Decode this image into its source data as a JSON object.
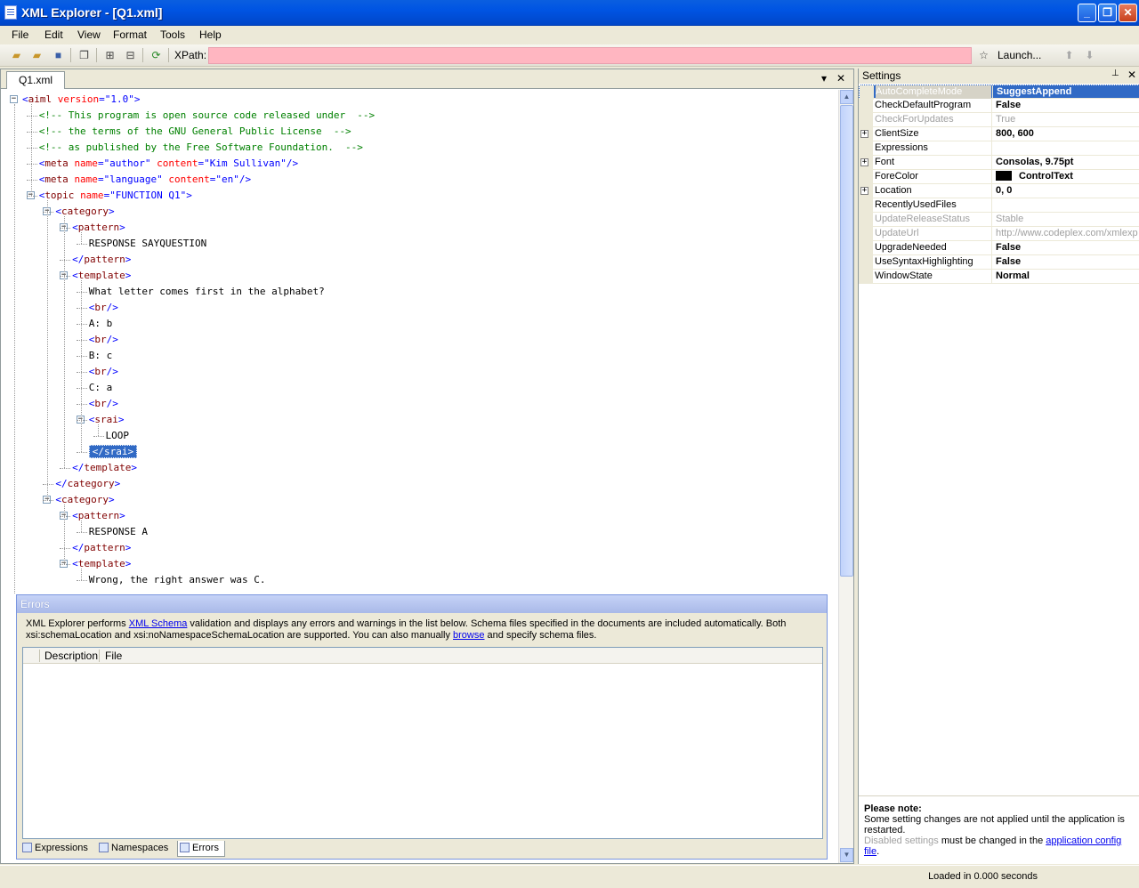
{
  "window": {
    "title": "XML Explorer - [Q1.xml]",
    "minimize": "_",
    "maximize": "❐",
    "close": "✕"
  },
  "menu": [
    "File",
    "Edit",
    "View",
    "Format",
    "Tools",
    "Help"
  ],
  "toolbar": {
    "xpath_label": "XPath:",
    "xpath_value": "",
    "launch_label": "Launch...",
    "icons": [
      "open-icon",
      "open-folder-icon",
      "save-icon",
      "copy-icon",
      "expand-all-icon",
      "collapse-all-icon",
      "refresh-icon",
      "star-icon",
      "launch-icon",
      "up-arrow-icon",
      "down-arrow-icon"
    ]
  },
  "editor": {
    "tab": "Q1.xml",
    "lines": [
      {
        "kind": "element",
        "text": "<aiml",
        "attrs": [
          {
            "n": "version",
            "v": "\"1.0\""
          }
        ],
        "close": ">"
      },
      {
        "kind": "comment",
        "text": "<!-- This program is open source code released under  -->"
      },
      {
        "kind": "comment",
        "text": "<!-- the terms of the GNU General Public License  -->"
      },
      {
        "kind": "comment",
        "text": "<!-- as published by the Free Software Foundation.  -->"
      },
      {
        "kind": "element",
        "text": "<meta",
        "attrs": [
          {
            "n": "name",
            "v": "\"author\""
          },
          {
            "n": "content",
            "v": "\"Kim Sullivan\""
          }
        ],
        "close": "/>"
      },
      {
        "kind": "element",
        "text": "<meta",
        "attrs": [
          {
            "n": "name",
            "v": "\"language\""
          },
          {
            "n": "content",
            "v": "\"en\""
          }
        ],
        "close": "/>"
      },
      {
        "kind": "element",
        "text": "<topic",
        "attrs": [
          {
            "n": "name",
            "v": "\"FUNCTION Q1\""
          }
        ],
        "close": ">"
      },
      {
        "kind": "element",
        "text": "<category",
        "attrs": [],
        "close": ">"
      },
      {
        "kind": "element",
        "text": "<pattern",
        "attrs": [],
        "close": ">"
      },
      {
        "kind": "text",
        "text": "RESPONSE SAYQUESTION"
      },
      {
        "kind": "endtag",
        "text": "</pattern>"
      },
      {
        "kind": "element",
        "text": "<template",
        "attrs": [],
        "close": ">"
      },
      {
        "kind": "text",
        "text": "What letter comes first in the alphabet?"
      },
      {
        "kind": "endtag",
        "text": "<br/>"
      },
      {
        "kind": "text",
        "text": "A: b"
      },
      {
        "kind": "endtag",
        "text": "<br/>"
      },
      {
        "kind": "text",
        "text": "B: c"
      },
      {
        "kind": "endtag",
        "text": "<br/>"
      },
      {
        "kind": "text",
        "text": "C: a"
      },
      {
        "kind": "endtag",
        "text": "<br/>"
      },
      {
        "kind": "element",
        "text": "<srai",
        "attrs": [],
        "close": ">"
      },
      {
        "kind": "text",
        "text": "LOOP"
      },
      {
        "kind": "endtag",
        "text": "</srai>",
        "selected": true
      },
      {
        "kind": "endtag",
        "text": "</template>"
      },
      {
        "kind": "endtag",
        "text": "</category>"
      },
      {
        "kind": "element",
        "text": "<category",
        "attrs": [],
        "close": ">"
      },
      {
        "kind": "element",
        "text": "<pattern",
        "attrs": [],
        "close": ">"
      },
      {
        "kind": "text",
        "text": "RESPONSE A"
      },
      {
        "kind": "endtag",
        "text": "</pattern>"
      },
      {
        "kind": "element",
        "text": "<template",
        "attrs": [],
        "close": ">"
      },
      {
        "kind": "text",
        "text": "Wrong, the right answer was C."
      }
    ]
  },
  "errors": {
    "title": "Errors",
    "message_1": "XML Explorer performs ",
    "link_schema": "XML Schema",
    "message_2": " validation and displays any errors and warnings in the list below. Schema files specified in the documents are included automatically. Both xsi:schemaLocation and xsi:noNamespaceSchemaLocation are supported. You can also manually ",
    "link_browse": "browse",
    "message_3": " and specify schema files.",
    "columns": [
      "Description",
      "File"
    ],
    "tabs": [
      "Expressions",
      "Namespaces",
      "Errors"
    ]
  },
  "settings": {
    "title": "Settings",
    "pin": "📌",
    "close": "✕",
    "rows": [
      {
        "name": "AutoCompleteMode",
        "value": "SuggestAppend",
        "selected": true
      },
      {
        "name": "CheckDefaultProgram",
        "value": "False"
      },
      {
        "name": "CheckForUpdates",
        "value": "True",
        "disabled": true
      },
      {
        "name": "ClientSize",
        "value": "800, 600",
        "expandable": true
      },
      {
        "name": "Expressions",
        "value": ""
      },
      {
        "name": "Font",
        "value": "Consolas, 9.75pt",
        "expandable": true
      },
      {
        "name": "ForeColor",
        "value": "ControlText",
        "swatch": true
      },
      {
        "name": "Location",
        "value": "0, 0",
        "expandable": true
      },
      {
        "name": "RecentlyUsedFiles",
        "value": ""
      },
      {
        "name": "UpdateReleaseStatus",
        "value": "Stable",
        "disabled": true
      },
      {
        "name": "UpdateUrl",
        "value": "http://www.codeplex.com/xmlexp",
        "disabled": true
      },
      {
        "name": "UpgradeNeeded",
        "value": "False"
      },
      {
        "name": "UseSyntaxHighlighting",
        "value": "False"
      },
      {
        "name": "WindowState",
        "value": "Normal"
      }
    ],
    "note_title": "Please note:",
    "note_text": "Some setting changes are not applied until the application is restarted.",
    "note_disabled": "Disabled settings",
    "note_mid": " must be changed in the ",
    "note_link": "application config file",
    "note_end": "."
  },
  "status": {
    "text": "Loaded in 0.000 seconds"
  }
}
